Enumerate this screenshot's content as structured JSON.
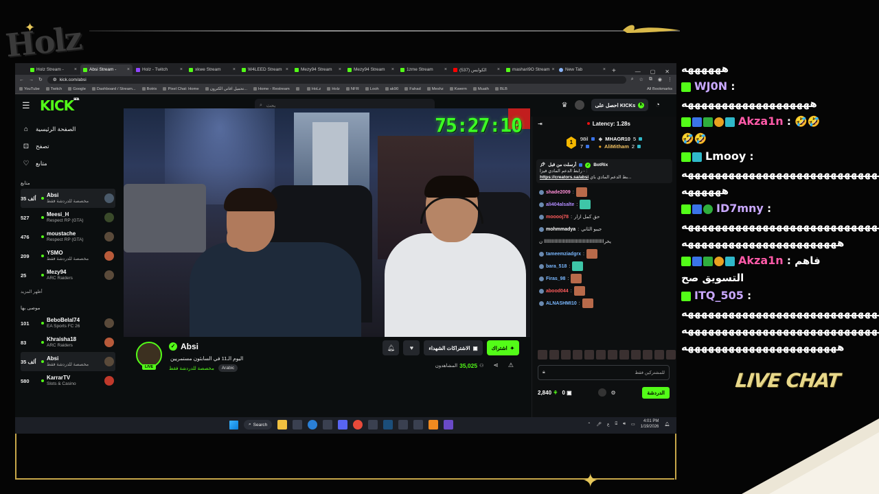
{
  "overlay": {
    "logo_text": "Holz",
    "live_chat_title": "LIVE CHAT"
  },
  "browser": {
    "tabs": [
      {
        "label": "Holz Stream -",
        "fav": "kick"
      },
      {
        "label": "Absi Stream -",
        "fav": "kick",
        "active": true
      },
      {
        "label": "Holz - Twitch",
        "fav": "twitch"
      },
      {
        "label": "xkwe Stream",
        "fav": "kick"
      },
      {
        "label": "W4LEED Stream",
        "fav": "kick"
      },
      {
        "label": "Mezy94 Stream",
        "fav": "kick"
      },
      {
        "label": "Mezy94 Stream",
        "fav": "kick"
      },
      {
        "label": "1zme Stream",
        "fav": "kick"
      },
      {
        "label": "(537) الكوايس",
        "fav": "youtube"
      },
      {
        "label": "mashari9O Stream",
        "fav": "kick"
      },
      {
        "label": "New Tab",
        "fav": "newtab"
      }
    ],
    "new_tab_symbol": "+",
    "url": "kick.com/absi",
    "bookmarks": [
      "YouTube",
      "Twitch",
      "Google",
      "Dashboard / Stream...",
      "Botrix",
      "Pixel Chat: Home",
      "تحميل اغاني الكترون...",
      "Home - Restream",
      "",
      "HoLz",
      "Holz",
      "NFR",
      "Looh",
      "ak90",
      "Fahad",
      "Meshz",
      "Kwerm",
      "Muath",
      "BLB"
    ],
    "all_bookmarks": "All Bookmarks"
  },
  "kick": {
    "logo": "KICK",
    "logo_beta": "BETA",
    "search_placeholder": "بحث",
    "get_kicks_label": "احصل على KICKs",
    "nav": [
      {
        "label": "الصفحة الرئيسية",
        "icon": "home-icon"
      },
      {
        "label": "تصفح",
        "icon": "browse-icon"
      },
      {
        "label": "متابع",
        "icon": "heart-icon"
      }
    ],
    "following_title": "متابع",
    "following": [
      {
        "count": "35 ألف",
        "name": "Absi",
        "category": "مخصصة للدردشة فقط",
        "highlight": true
      },
      {
        "count": "527",
        "name": "Meesi_H",
        "category": "Respect RP (GTA)"
      },
      {
        "count": "476",
        "name": "moustache",
        "category": "Respect RP (GTA)"
      },
      {
        "count": "209",
        "name": "YSMO",
        "category": "مخصصة للدردشة فقط"
      },
      {
        "count": "25",
        "name": "Mezy94",
        "category": "ARC Raiders"
      }
    ],
    "show_more": "أظهر المزيد",
    "recommended_title": "موصى بها",
    "recommended": [
      {
        "count": "101",
        "name": "BeboBelal74",
        "category": "EA Sports FC 26"
      },
      {
        "count": "83",
        "name": "Khraisha18",
        "category": "ARC Raiders"
      },
      {
        "count": "35 ألف",
        "name": "Absi",
        "category": "مخصصة للدردشة فقط",
        "highlight": true
      },
      {
        "count": "580",
        "name": "KarrarTV",
        "category": "Slots & Casino"
      }
    ],
    "video": {
      "timer": "75:27:10"
    },
    "stream": {
      "live_badge": "LIVE",
      "name": "Absi",
      "title": "اليوم الـ11 في السابثون مستمريين",
      "category": "مخصصة للدردشة فقط",
      "tag": "Arabic",
      "gift_label": "الاشتراكات الشهداء",
      "sub_label": "اشتراك",
      "viewers_label": "المشاهدون",
      "viewers_count": "35,025"
    },
    "chat": {
      "latency": "Latency: 1.28s",
      "leaderboard": {
        "rank_badge": "1",
        "left": [
          {
            "value": "98il"
          },
          {
            "value": "7"
          }
        ],
        "right": [
          {
            "name": "MHAGR10",
            "value": "5"
          },
          {
            "name": "AliMitham",
            "value": "2"
          }
        ]
      },
      "pinned": {
        "header": "أرسلت من قبل",
        "user": "BotRix",
        "text": "رابط الدعم المادي فيزا - :",
        "link": "https://creators.sa/absi",
        "link_suffix": "بط الدعم المادي باي..."
      },
      "messages": [
        {
          "user": "shade2009",
          "color": "#ff8fd8",
          "text": "",
          "emote": "face"
        },
        {
          "user": "ali404alsalte",
          "color": "#b28cff",
          "text": "",
          "emote": "teal"
        },
        {
          "user": "mooooj78",
          "color": "#ff5c5c",
          "text": "حق كمل ازار",
          "emote": ""
        },
        {
          "user": "mohmmadya",
          "color": "#ffffff",
          "text": "جيبو الثاني",
          "emote": ""
        },
        {
          "user": "",
          "color": "#ffffff",
          "text": "يخرااااااااااااااااااااااااااااااااااااااااااااا ن",
          "emote": ""
        },
        {
          "user": "tameemziadgrx",
          "color": "#7ab8ff",
          "text": "",
          "emote": "face"
        },
        {
          "user": "bara_518",
          "color": "#7ab8ff",
          "text": "",
          "emote": "teal"
        },
        {
          "user": "Firas_98",
          "color": "#7ab8ff",
          "text": "",
          "emote": "face"
        },
        {
          "user": "abood044",
          "color": "#ff5c5c",
          "text": "",
          "emote": "face"
        },
        {
          "user": "ALNASHMI10",
          "color": "#7ab8ff",
          "text": "",
          "emote": "face"
        }
      ],
      "input_placeholder": "للمشتركين فقط",
      "points": "2,840",
      "gifts": "0",
      "send_label": "الدردشة"
    }
  },
  "taskbar": {
    "search_label": "Search",
    "time": "4:01 PM",
    "date": "1/19/2026",
    "lang": "ع"
  },
  "live_chat": [
    {
      "user": "",
      "badges": [],
      "text": "ههههههه"
    },
    {
      "user": "WJ0N",
      "color": "#c9a8ff",
      "badges": [
        "k"
      ],
      "text": ":"
    },
    {
      "user": "",
      "badges": [],
      "text": "هههههههههههههههههههه"
    },
    {
      "user": "Akza1n",
      "color": "#ff5aa8",
      "badges": [
        "k",
        "s",
        "g",
        "o",
        "c"
      ],
      "text": ": 🤣🤣"
    },
    {
      "user": "",
      "badges": [],
      "text": "🤣🤣"
    },
    {
      "user": "Lmooy",
      "color": "#ffffff",
      "badges": [
        "k",
        "c"
      ],
      "text": ":"
    },
    {
      "user": "",
      "badges": [],
      "text": "هههههههههههههههههههههههههههههههههههه"
    },
    {
      "user": "",
      "badges": [],
      "text": "ههههههه"
    },
    {
      "user": "ID7mny",
      "color": "#c9a8ff",
      "badges": [
        "k",
        "s",
        "v"
      ],
      "text": ":"
    },
    {
      "user": "",
      "badges": [],
      "text": "هههههههههههههههههههههههههههههههههههه"
    },
    {
      "user": "",
      "badges": [],
      "text": "هههههههههههههههههههههههه"
    },
    {
      "user": "Akza1n",
      "color": "#ff5aa8",
      "badges": [
        "k",
        "s",
        "g",
        "o",
        "c"
      ],
      "text": ": فاهم"
    },
    {
      "user": "",
      "badges": [],
      "text": "التسويق صح"
    },
    {
      "user": "ITQ_505",
      "color": "#c9a8ff",
      "badges": [
        "k"
      ],
      "text": ":"
    },
    {
      "user": "",
      "badges": [],
      "text": "هههههههههههههههههههههههههههههههههههه"
    },
    {
      "user": "",
      "badges": [],
      "text": "هههههههههههههههههههههههههههههههههههههه"
    },
    {
      "user": "",
      "badges": [],
      "text": "هههههههههههههههههههههههه"
    }
  ]
}
